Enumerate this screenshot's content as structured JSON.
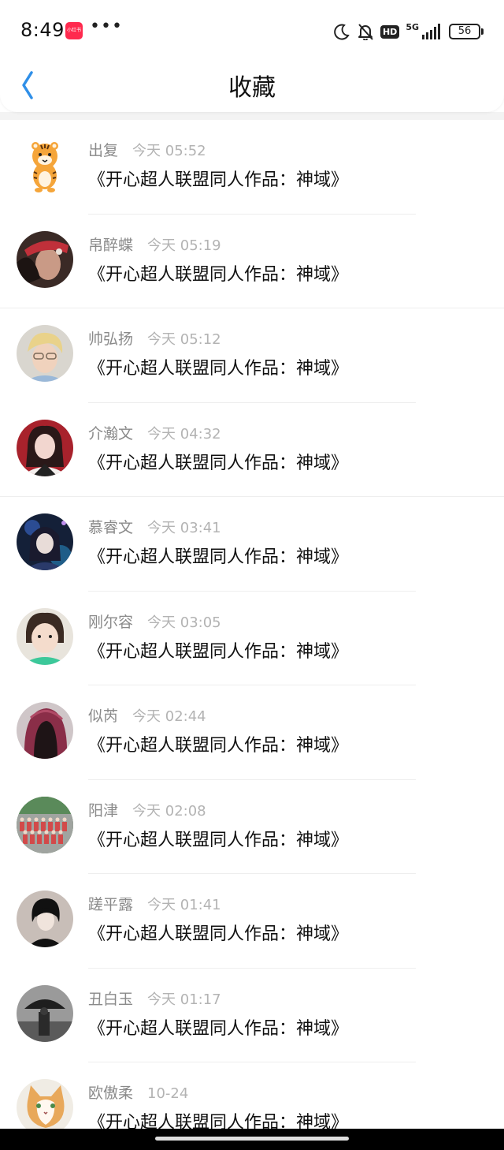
{
  "status_bar": {
    "time": "8:49",
    "app_badge": "小红书",
    "more": "•••",
    "hd": "HD",
    "network": "5G",
    "battery": "56"
  },
  "header": {
    "title": "收藏",
    "back_icon": "chevron-left-icon"
  },
  "favorites": [
    {
      "user": "出复",
      "time": "今天 05:52",
      "title": "《开心超人联盟同人作品：神域》",
      "avatar": "cartoon-tiger"
    },
    {
      "user": "帛醉蝶",
      "time": "今天 05:19",
      "title": "《开心超人联盟同人作品：神域》",
      "avatar": "girl-red-cap"
    },
    {
      "user": "帅弘扬",
      "time": "今天 05:12",
      "title": "《开心超人联盟同人作品：神域》",
      "avatar": "blond-boy"
    },
    {
      "user": "介瀚文",
      "time": "今天 04:32",
      "title": "《开心超人联盟同人作品：神域》",
      "avatar": "woman-portrait"
    },
    {
      "user": "慕睿文",
      "time": "今天 03:41",
      "title": "《开心超人联盟同人作品：神域》",
      "avatar": "anime-character"
    },
    {
      "user": "刚尔容",
      "time": "今天 03:05",
      "title": "《开心超人联盟同人作品：神域》",
      "avatar": "child-photo"
    },
    {
      "user": "似芮",
      "time": "今天 02:44",
      "title": "《开心超人联盟同人作品：神域》",
      "avatar": "red-hood"
    },
    {
      "user": "阳津",
      "time": "今天 02:08",
      "title": "《开心超人联盟同人作品：神域》",
      "avatar": "group-photo"
    },
    {
      "user": "蹉平露",
      "time": "今天 01:41",
      "title": "《开心超人联盟同人作品：神域》",
      "avatar": "anime-boy-dark"
    },
    {
      "user": "丑白玉",
      "time": "今天 01:17",
      "title": "《开心超人联盟同人作品：神域》",
      "avatar": "bw-umbrella"
    },
    {
      "user": "欧傲柔",
      "time": "10-24",
      "title": "《开心超人联盟同人作品：神域》",
      "avatar": "cat-photo"
    }
  ],
  "colors": {
    "accent": "#2f8fe8",
    "title_text": "#111111",
    "meta_text": "#8a8a8a",
    "time_text": "#b3b3b3",
    "badge": "#ff2a4e"
  }
}
